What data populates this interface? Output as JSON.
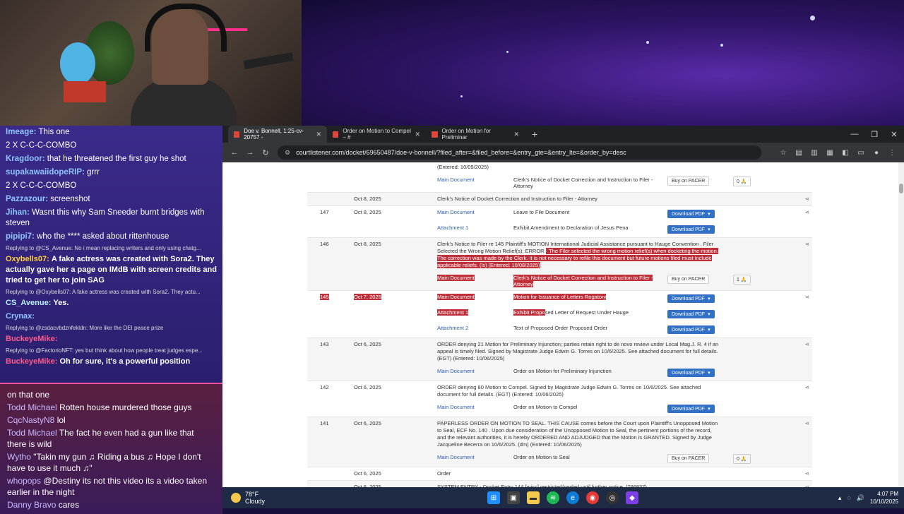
{
  "chat": {
    "lines": [
      {
        "name": "Imeage:",
        "text": "This one"
      },
      {
        "name": "",
        "text": "2 X C-C-C-COMBO"
      },
      {
        "name": "Kragdoor:",
        "text": "that he threatened the first guy he shot"
      },
      {
        "name": "supakawaiidopeRIP:",
        "text": "grrr"
      },
      {
        "name": "",
        "text": "2 X C-C-C-COMBO"
      },
      {
        "name": "Pazzazour:",
        "text": "screenshot"
      },
      {
        "name": "Jihan:",
        "text": "Wasnt this why Sam Sneeder burnt bridges with steven"
      },
      {
        "name": "pipipi7:",
        "text": "who the **** asked about rittenhouse"
      }
    ],
    "reply1": "Replying to @CS_Avenue: No i mean replacing writers and only using chatg...",
    "msg1_name": "Oxybells07:",
    "msg1_text": "A fake actress was created with Sora2. They actually gave her a page on IMdB with screen credits and tried to get her to join SAG",
    "reply2": "Replying to @Oxybells07: A fake actress was created with Sora2. They actu...",
    "msg2_name": "CS_Avenue:",
    "msg2_text": "Yes.",
    "msg3_name": "Crynax:",
    "msg3_text": "",
    "reply3": "Replying to @zsdacvbdznfekldn: More like the DEI peace prize",
    "msg4_name": "BuckeyeMike:",
    "msg4_text": "",
    "reply4": "Replying to @FactorioNFT: yes but think about how people treat judges espe...",
    "msg5_name": "BuckeyeMike:",
    "msg5_text": "Oh for sure, it's a powerful position"
  },
  "chat2": {
    "lines": [
      {
        "name": "",
        "text": "on that one"
      },
      {
        "name": "Todd Michael",
        "text": "Rotten house murdered those guys"
      },
      {
        "name": "CqcNastyN8",
        "text": "lol"
      },
      {
        "name": "Todd Michael",
        "text": "The fact he even had a gun like that there is wild"
      },
      {
        "name": "Wytho",
        "text": "\"Takin my gun ♫ Riding a bus ♫ Hope I don't have to use it much ♫\""
      },
      {
        "name": "whopops",
        "text": "@Destiny its not this video its a video taken earlier in the night"
      },
      {
        "name": "Danny Bravo",
        "text": "cares"
      }
    ]
  },
  "browser": {
    "tabs": [
      {
        "label": "Doe v. Bonnell, 1:25-cv-20757 -"
      },
      {
        "label": "Order on Motion to Compel – #"
      },
      {
        "label": "Order on Motion for Preliminar"
      }
    ],
    "url": "courtlistener.com/docket/69650487/doe-v-bonnell/?filed_after=&filed_before=&entry_gte=&entry_lte=&order_by=desc"
  },
  "docket": {
    "top_entered": "(Entered: 10/09/2025)",
    "top_main": "Main Document",
    "top_desc": "Clerk's Notice of Docket Correction and Instruction to Filer - Attorney",
    "buy_label": "Buy on PACER",
    "download_label": "Download PDF",
    "top_count": "0",
    "e0_date": "Oct 8, 2025",
    "e0_desc": "Clerk's Notice of Docket Correction and Instruction to Filer - Attorney",
    "e147_num": "147",
    "e147_date": "Oct 8, 2025",
    "e147_a": "Main Document",
    "e147_a_desc": "Leave to File Document",
    "e147_b": "Attachment 1",
    "e147_b_desc": "Exhibit Amendment to Declaration of Jesus Pena",
    "e146_num": "146",
    "e146_date": "Oct 8, 2025",
    "e146_text1": "Clerk's Notice to Filer re 145 Plaintiff's MOTION International Judicial Assistance pursuant to Hauge Convention . Filer Selected the Wrong Motion Relief(s); ERROR",
    "e146_text2": "- The Filer selected the wrong motion relief(s) when docketing the motion. The correction was made by the Clerk. It is not necessary to refile this document but future motions filed must include applicable reliefs. (ls) (Entered: 10/08/2025)",
    "e146_main": "Main Document",
    "e146_main_desc": "Clerk's Notice of Docket Correction and Instruction to Filer - Attorney",
    "e146_count": "1",
    "e145_num": "145",
    "e145_date": "Oct 7, 2025",
    "e145_a": "Main Document",
    "e145_a_desc": "Motion for Issuance of Letters Rogatory",
    "e145_b": "Attachment 1",
    "e145_b_desc_hl": "Exhibit Propo",
    "e145_b_desc": "sed Letter of Request Under Hauge",
    "e145_c": "Attachment 2",
    "e145_c_desc": "Text of Proposed Order Proposed Order",
    "e143_num": "143",
    "e143_date": "Oct 6, 2025",
    "e143_text": "ORDER denying 21 Motion for Preliminary Injunction; parties retain right to de novo review under Local Mag.J. R. 4 if an appeal is timely filed. Signed by Magistrate Judge Edwin G. Torres on 10/6/2025. See attached document for full details. (EGT) (Entered: 10/06/2025)",
    "e143_main": "Main Document",
    "e143_main_desc": "Order on Motion for Preliminary Injunction",
    "e142_num": "142",
    "e142_date": "Oct 6, 2025",
    "e142_text": "ORDER denying 80 Motion to Compel. Signed by Magistrate Judge Edwin G. Torres on 10/6/2025. See attached document for full details. (EGT) (Entered: 10/06/2025)",
    "e142_main": "Main Document",
    "e142_main_desc": "Order on Motion to Compel",
    "e141_num": "141",
    "e141_date": "Oct 6, 2025",
    "e141_text": "PAPERLESS ORDER ON MOTION TO SEAL. THIS CAUSE comes before the Court upon Plaintiff's Unopposed Motion to Seal, ECF No. 140 . Upon due consideration of the Unopposed Motion to Seal, the pertinent portions of the record, and the relevant authorities, it is hereby ORDERED AND ADJUDGED that the Motion is GRANTED. Signed by Judge Jacqueline Becerra on 10/6/2025. (dm) (Entered: 10/06/2025)",
    "e141_main": "Main Document",
    "e141_main_desc": "Order on Motion to Seal",
    "e141_count": "0",
    "e140_date": "Oct 6, 2025",
    "e140_text": "Order",
    "e139_date": "Oct 6, 2025",
    "e139_text": "SYSTEM ENTRY - Docket Entry 144 [misc] restricted/sealed until further notice. (766837)"
  },
  "taskbar": {
    "temp": "78°F",
    "cond": "Cloudy",
    "time": "4:07 PM",
    "date": "10/10/2025"
  }
}
